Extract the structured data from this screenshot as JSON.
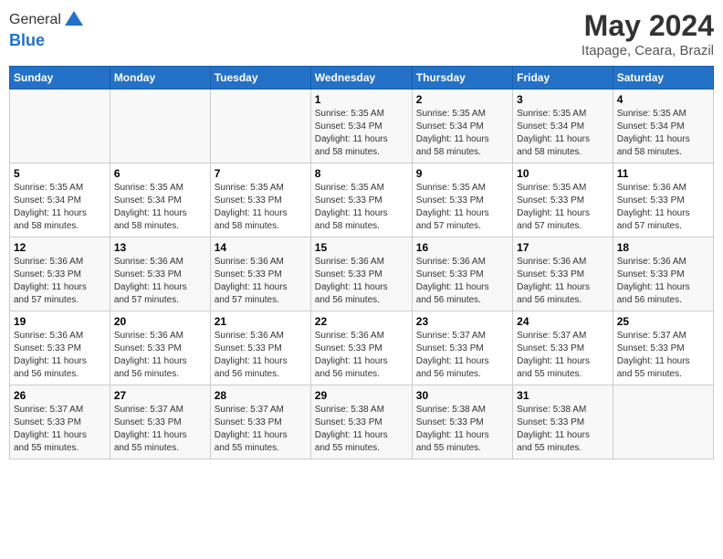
{
  "header": {
    "logo_line1": "General",
    "logo_line2": "Blue",
    "month": "May 2024",
    "location": "Itapage, Ceara, Brazil"
  },
  "weekdays": [
    "Sunday",
    "Monday",
    "Tuesday",
    "Wednesday",
    "Thursday",
    "Friday",
    "Saturday"
  ],
  "rows": [
    [
      {
        "day": "",
        "info": ""
      },
      {
        "day": "",
        "info": ""
      },
      {
        "day": "",
        "info": ""
      },
      {
        "day": "1",
        "info": "Sunrise: 5:35 AM\nSunset: 5:34 PM\nDaylight: 11 hours\nand 58 minutes."
      },
      {
        "day": "2",
        "info": "Sunrise: 5:35 AM\nSunset: 5:34 PM\nDaylight: 11 hours\nand 58 minutes."
      },
      {
        "day": "3",
        "info": "Sunrise: 5:35 AM\nSunset: 5:34 PM\nDaylight: 11 hours\nand 58 minutes."
      },
      {
        "day": "4",
        "info": "Sunrise: 5:35 AM\nSunset: 5:34 PM\nDaylight: 11 hours\nand 58 minutes."
      }
    ],
    [
      {
        "day": "5",
        "info": "Sunrise: 5:35 AM\nSunset: 5:34 PM\nDaylight: 11 hours\nand 58 minutes."
      },
      {
        "day": "6",
        "info": "Sunrise: 5:35 AM\nSunset: 5:34 PM\nDaylight: 11 hours\nand 58 minutes."
      },
      {
        "day": "7",
        "info": "Sunrise: 5:35 AM\nSunset: 5:33 PM\nDaylight: 11 hours\nand 58 minutes."
      },
      {
        "day": "8",
        "info": "Sunrise: 5:35 AM\nSunset: 5:33 PM\nDaylight: 11 hours\nand 58 minutes."
      },
      {
        "day": "9",
        "info": "Sunrise: 5:35 AM\nSunset: 5:33 PM\nDaylight: 11 hours\nand 57 minutes."
      },
      {
        "day": "10",
        "info": "Sunrise: 5:35 AM\nSunset: 5:33 PM\nDaylight: 11 hours\nand 57 minutes."
      },
      {
        "day": "11",
        "info": "Sunrise: 5:36 AM\nSunset: 5:33 PM\nDaylight: 11 hours\nand 57 minutes."
      }
    ],
    [
      {
        "day": "12",
        "info": "Sunrise: 5:36 AM\nSunset: 5:33 PM\nDaylight: 11 hours\nand 57 minutes."
      },
      {
        "day": "13",
        "info": "Sunrise: 5:36 AM\nSunset: 5:33 PM\nDaylight: 11 hours\nand 57 minutes."
      },
      {
        "day": "14",
        "info": "Sunrise: 5:36 AM\nSunset: 5:33 PM\nDaylight: 11 hours\nand 57 minutes."
      },
      {
        "day": "15",
        "info": "Sunrise: 5:36 AM\nSunset: 5:33 PM\nDaylight: 11 hours\nand 56 minutes."
      },
      {
        "day": "16",
        "info": "Sunrise: 5:36 AM\nSunset: 5:33 PM\nDaylight: 11 hours\nand 56 minutes."
      },
      {
        "day": "17",
        "info": "Sunrise: 5:36 AM\nSunset: 5:33 PM\nDaylight: 11 hours\nand 56 minutes."
      },
      {
        "day": "18",
        "info": "Sunrise: 5:36 AM\nSunset: 5:33 PM\nDaylight: 11 hours\nand 56 minutes."
      }
    ],
    [
      {
        "day": "19",
        "info": "Sunrise: 5:36 AM\nSunset: 5:33 PM\nDaylight: 11 hours\nand 56 minutes."
      },
      {
        "day": "20",
        "info": "Sunrise: 5:36 AM\nSunset: 5:33 PM\nDaylight: 11 hours\nand 56 minutes."
      },
      {
        "day": "21",
        "info": "Sunrise: 5:36 AM\nSunset: 5:33 PM\nDaylight: 11 hours\nand 56 minutes."
      },
      {
        "day": "22",
        "info": "Sunrise: 5:36 AM\nSunset: 5:33 PM\nDaylight: 11 hours\nand 56 minutes."
      },
      {
        "day": "23",
        "info": "Sunrise: 5:37 AM\nSunset: 5:33 PM\nDaylight: 11 hours\nand 56 minutes."
      },
      {
        "day": "24",
        "info": "Sunrise: 5:37 AM\nSunset: 5:33 PM\nDaylight: 11 hours\nand 55 minutes."
      },
      {
        "day": "25",
        "info": "Sunrise: 5:37 AM\nSunset: 5:33 PM\nDaylight: 11 hours\nand 55 minutes."
      }
    ],
    [
      {
        "day": "26",
        "info": "Sunrise: 5:37 AM\nSunset: 5:33 PM\nDaylight: 11 hours\nand 55 minutes."
      },
      {
        "day": "27",
        "info": "Sunrise: 5:37 AM\nSunset: 5:33 PM\nDaylight: 11 hours\nand 55 minutes."
      },
      {
        "day": "28",
        "info": "Sunrise: 5:37 AM\nSunset: 5:33 PM\nDaylight: 11 hours\nand 55 minutes."
      },
      {
        "day": "29",
        "info": "Sunrise: 5:38 AM\nSunset: 5:33 PM\nDaylight: 11 hours\nand 55 minutes."
      },
      {
        "day": "30",
        "info": "Sunrise: 5:38 AM\nSunset: 5:33 PM\nDaylight: 11 hours\nand 55 minutes."
      },
      {
        "day": "31",
        "info": "Sunrise: 5:38 AM\nSunset: 5:33 PM\nDaylight: 11 hours\nand 55 minutes."
      },
      {
        "day": "",
        "info": ""
      }
    ]
  ]
}
